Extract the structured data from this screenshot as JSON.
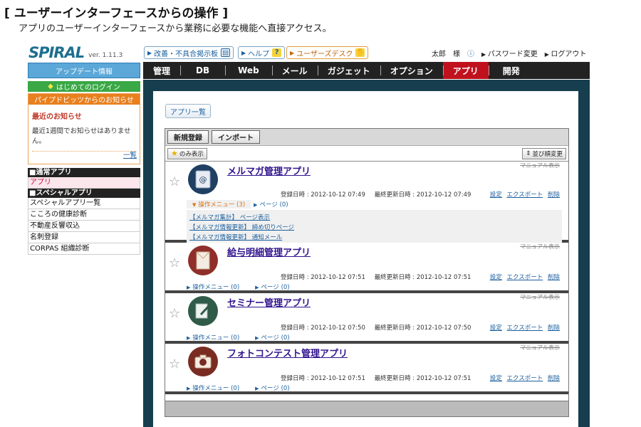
{
  "header": {
    "title": "[ ユーザーインターフェースからの操作 ]",
    "subtitle": "アプリのユーザーインターフェースから業務に必要な機能へ直接アクセス。"
  },
  "topbar": {
    "logo": "SPIRAL",
    "version": "ver. 1.11.3",
    "buttons": [
      {
        "label": "改善・不具合掲示板",
        "icon": "board-icon"
      },
      {
        "label": "ヘルプ",
        "icon": "help-icon"
      },
      {
        "label": "ユーザーズデスク",
        "icon": "desk-icon"
      }
    ],
    "user_name": "太郎　様",
    "password_link": "パスワード変更",
    "logout_link": "ログアウト"
  },
  "sidebar": {
    "update_label": "アップデート情報",
    "first_login_label": "はじめてのログイン",
    "news": {
      "header": "パイプドビッツからのお知らせ",
      "title": "最近のお知らせ",
      "body": "最近1週間でお知らせはありません。",
      "more": "一覧"
    },
    "sections": [
      {
        "title": "■通常アプリ",
        "items": [
          "アプリ"
        ]
      },
      {
        "title": "■スペシャルアプリ",
        "items": [
          "スペシャルアプリ一覧",
          "こころの健康診断",
          "不動産反響収込",
          "名刺登録",
          "CORPAS 組織診断"
        ]
      }
    ]
  },
  "nav": {
    "items": [
      "管理",
      "DB",
      "Web",
      "メール",
      "ガジェット",
      "オプション",
      "アプリ",
      "開発"
    ],
    "active": "アプリ"
  },
  "main": {
    "applist_button": "アプリ一覧",
    "toolbar": {
      "new_label": "新規登録",
      "import_label": "インポート"
    },
    "filter_label": "のみ表示",
    "sort_label": "並び順変更",
    "apps": [
      {
        "name": "メルマガ管理アプリ",
        "manual": "マニュアル表示",
        "registered": "登録日時 : 2012-10-12 07:49",
        "updated": "最終更新日時 : 2012-10-12 07:49",
        "menu": "操作メニュー (3)",
        "page": "ページ (0)",
        "submenu": [
          "【メルマガ集計】 ページ表示",
          "【メルマガ情報更新】 締め切りページ",
          "【メルマガ情報更新】 通知メール"
        ],
        "icon_color": "#1f3f63",
        "icon": "mail-icon"
      },
      {
        "name": "給与明細管理アプリ",
        "manual": "マニュアル表示",
        "registered": "登録日時 : 2012-10-12 07:51",
        "updated": "最終更新日時 : 2012-10-12 07:51",
        "menu": "操作メニュー (0)",
        "page": "ページ (0)",
        "icon_color": "#8f2e2a",
        "icon": "envelope-icon"
      },
      {
        "name": "セミナー管理アプリ",
        "manual": "マニュアル表示",
        "registered": "登録日時 : 2012-10-12 07:50",
        "updated": "最終更新日時 : 2012-10-12 07:50",
        "menu": "操作メニュー (0)",
        "page": "ページ (0)",
        "icon_color": "#2f5b48",
        "icon": "pen-icon"
      },
      {
        "name": "フォトコンテスト管理アプリ",
        "manual": "マニュアル表示",
        "registered": "登録日時 : 2012-10-12 07:51",
        "updated": "最終更新日時 : 2012-10-12 07:51",
        "menu": "操作メニュー (0)",
        "page": "ページ (0)",
        "icon_color": "#7a2c22",
        "icon": "camera-icon"
      }
    ],
    "actions": {
      "settings": "設定",
      "export": "エクスポート",
      "delete": "削除"
    }
  }
}
